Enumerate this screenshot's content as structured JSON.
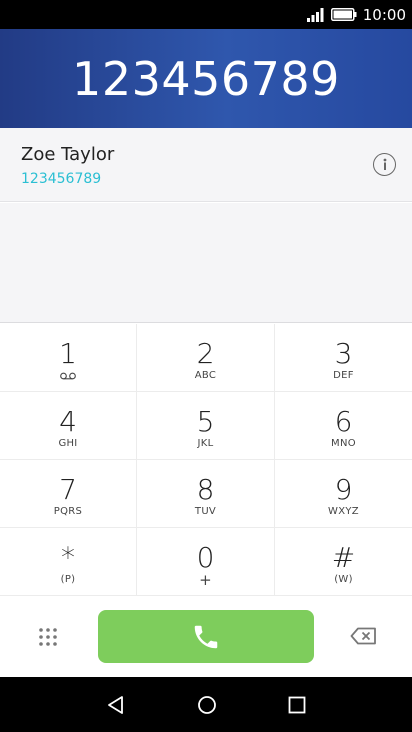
{
  "status_bar": {
    "time": "10:00",
    "icons": [
      "signal-icon",
      "battery-icon"
    ]
  },
  "dialer": {
    "entered_number": "123456789"
  },
  "suggestion": {
    "contact_name": "Zoe Taylor",
    "contact_number": "123456789",
    "info_icon": "info-icon"
  },
  "keypad": {
    "keys": [
      {
        "digit": "1",
        "sub": ""
      },
      {
        "digit": "2",
        "sub": "ABC"
      },
      {
        "digit": "3",
        "sub": "DEF"
      },
      {
        "digit": "4",
        "sub": "GHI"
      },
      {
        "digit": "5",
        "sub": "JKL"
      },
      {
        "digit": "6",
        "sub": "MNO"
      },
      {
        "digit": "7",
        "sub": "PQRS"
      },
      {
        "digit": "8",
        "sub": "TUV"
      },
      {
        "digit": "9",
        "sub": "WXYZ"
      },
      {
        "digit": "*",
        "sub": "(P)"
      },
      {
        "digit": "0",
        "sub": "+"
      },
      {
        "digit": "#",
        "sub": "(W)"
      }
    ]
  },
  "actions": {
    "call_icon": "phone-icon",
    "dialpad_icon": "dialpad-icon",
    "backspace_icon": "backspace-icon"
  },
  "colors": {
    "header_blue": "#2649a0",
    "call_green": "#7ecd5c",
    "number_accent": "#2bbfd3"
  },
  "nav_bar": {
    "buttons": [
      "back-icon",
      "home-icon",
      "recents-icon"
    ]
  }
}
